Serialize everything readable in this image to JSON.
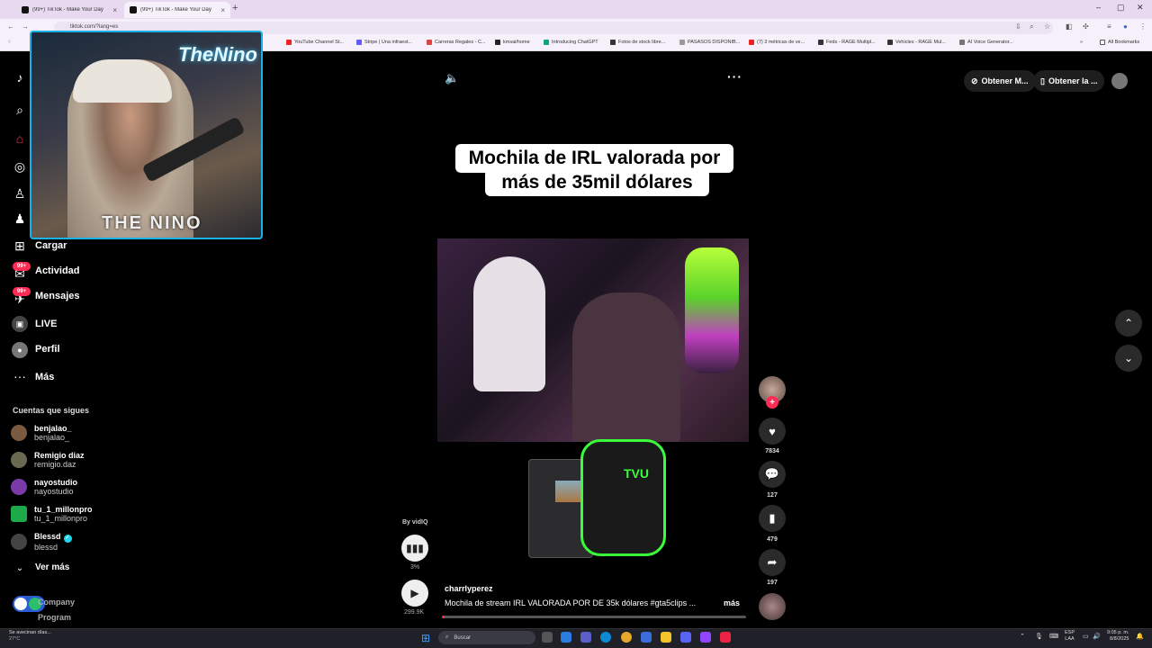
{
  "browser": {
    "tabs": [
      {
        "title": "(99+) TikTok - Make Your Day",
        "active": false
      },
      {
        "title": "(99+) TikTok - Make Your Day",
        "active": true
      }
    ],
    "url": "tiktok.com/?lang=es",
    "bookmarks": [
      "YouTube Channel St...",
      "Stripe | Una infraest...",
      "Carreras Regales - C...",
      "kmsai/home",
      "Introducing ChatGPT",
      "Fotos de stock libre...",
      "PASASOS DISPONIB...",
      "(7) 3 métricas de ve...",
      "Feds - RAGE Multipl...",
      "Vehicles - RAGE Mul...",
      "AI Voice Generator...",
      "All Bookmarks"
    ]
  },
  "webcam": {
    "neon_text": "TheNino",
    "overlay_text": "THE NINO"
  },
  "sidebar": {
    "items": [
      {
        "label": "Cargar",
        "icon": "plus-square-icon"
      },
      {
        "label": "Actividad",
        "icon": "activity-icon",
        "badge": "99+"
      },
      {
        "label": "Mensajes",
        "icon": "messages-icon",
        "badge": "99+"
      },
      {
        "label": "LIVE",
        "icon": "live-icon"
      },
      {
        "label": "Perfil",
        "icon": "profile-icon"
      },
      {
        "label": "Más",
        "icon": "more-dots-icon"
      }
    ],
    "following_title": "Cuentas que sigues",
    "accounts": [
      {
        "name": "benjalao_",
        "user": "benjalao_",
        "color": "#7a5a40"
      },
      {
        "name": "Remigio diaz",
        "user": "remigio.daz",
        "color": "#6a6a52"
      },
      {
        "name": "nayostudio",
        "user": "nayostudio",
        "color": "#7a3aa8"
      },
      {
        "name": "tu_1_millonpro",
        "user": "tu_1_millonpro",
        "color": "#1fa84a"
      },
      {
        "name": "Blessd",
        "user": "blessd",
        "color": "#444444",
        "verified": true
      }
    ],
    "see_more": "Ver más",
    "footer": [
      "Company",
      "Program"
    ]
  },
  "video": {
    "caption_line1": "Mochila de IRL valorada por",
    "caption_line2": "más de 35mil dólares",
    "product_label": "TVU",
    "vidiq_by": "By vidIQ",
    "vidiq_pct": "3%",
    "views": "299.9K",
    "author": "charrlyperez",
    "description": "Mochila de stream IRL VALORADA POR DE 35k dólares #gta5clips ...",
    "more": "más",
    "progress": 0.01
  },
  "actions": {
    "likes": "7834",
    "comments": "127",
    "saves": "479",
    "shares": "197"
  },
  "topright": {
    "btn1": "Obtener M...",
    "btn2": "Obtener la ..."
  },
  "taskbar": {
    "weather_text": "Se avecinan días...",
    "temp": "27°C",
    "search_placeholder": "Buscar",
    "lang": "ESP",
    "lang2": "LAA",
    "time": "9:05 p. m.",
    "date": "8/8/2025"
  },
  "colors": {
    "accent": "#fe2c55",
    "webcam_border": "#1ab0e8",
    "neon_green": "#39ff3a"
  }
}
